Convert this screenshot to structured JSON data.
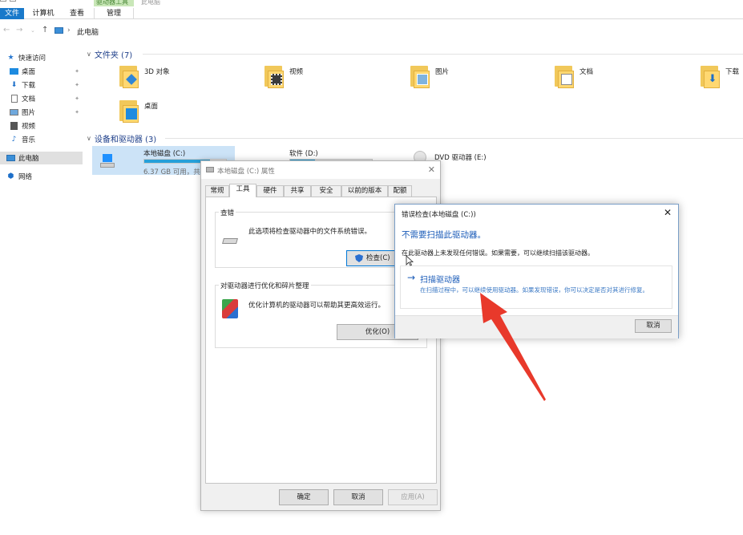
{
  "ribbon": {
    "context_group": "驱动器工具",
    "window_title": "此电脑",
    "tabs": {
      "file": "文件",
      "computer": "计算机",
      "view": "查看",
      "manage": "管理"
    }
  },
  "address": {
    "path": "此电脑"
  },
  "nav": {
    "items": [
      {
        "label": "快速访问",
        "icon": "star-icon"
      },
      {
        "label": "桌面",
        "icon": "desktop-icon"
      },
      {
        "label": "下载",
        "icon": "download-icon"
      },
      {
        "label": "文档",
        "icon": "document-icon"
      },
      {
        "label": "图片",
        "icon": "picture-icon"
      },
      {
        "label": "视频",
        "icon": "video-icon"
      },
      {
        "label": "音乐",
        "icon": "music-icon"
      },
      {
        "label": "此电脑",
        "icon": "computer-icon"
      },
      {
        "label": "网络",
        "icon": "network-icon"
      }
    ]
  },
  "folders": {
    "header": "文件夹 (7)",
    "items": [
      {
        "label": "3D 对象",
        "icon": "3d-objects-icon"
      },
      {
        "label": "视频",
        "icon": "video-folder-icon"
      },
      {
        "label": "图片",
        "icon": "pictures-folder-icon"
      },
      {
        "label": "文档",
        "icon": "documents-folder-icon"
      },
      {
        "label": "下载",
        "icon": "downloads-folder-icon"
      },
      {
        "label": "桌面",
        "icon": "desktop-folder-icon"
      }
    ]
  },
  "drives": {
    "header": "设备和驱动器 (3)",
    "c": {
      "label": "本地磁盘 (C:)",
      "info": "6.37 GB 可用，共",
      "used_fraction": 0.8
    },
    "d": {
      "label": "软件 (D:)",
      "used_fraction": 0.3
    },
    "e": {
      "label": "DVD 驱动器 (E:)"
    }
  },
  "props": {
    "title": "本地磁盘 (C:) 属性",
    "tabs": [
      "常规",
      "工具",
      "硬件",
      "共享",
      "安全",
      "以前的版本",
      "配额"
    ],
    "error_group": "查错",
    "error_text": "此选项将检查驱动器中的文件系统错误。",
    "check_button": "检查(C)",
    "optimize_group": "对驱动器进行优化和碎片整理",
    "optimize_text": "优化计算机的驱动器可以帮助其更高效运行。",
    "optimize_button": "优化(O)",
    "ok": "确定",
    "cancel": "取消",
    "apply": "应用(A)"
  },
  "errcheck": {
    "title": "错误检查(本地磁盘 (C:))",
    "heading": "不需要扫描此驱动器。",
    "subtext": "在此驱动器上未发现任何错误。如果需要，可以继续扫描该驱动器。",
    "option_title": "扫描驱动器",
    "option_desc": "在扫描过程中，可以继续使用驱动器。如果发现错误，你可以决定是否对其进行修复。",
    "cancel": "取消"
  },
  "colors": {
    "accent": "#1979ca",
    "link": "#1a5bb8",
    "annotation_arrow": "#e8392b",
    "folder": "#ffd871"
  }
}
